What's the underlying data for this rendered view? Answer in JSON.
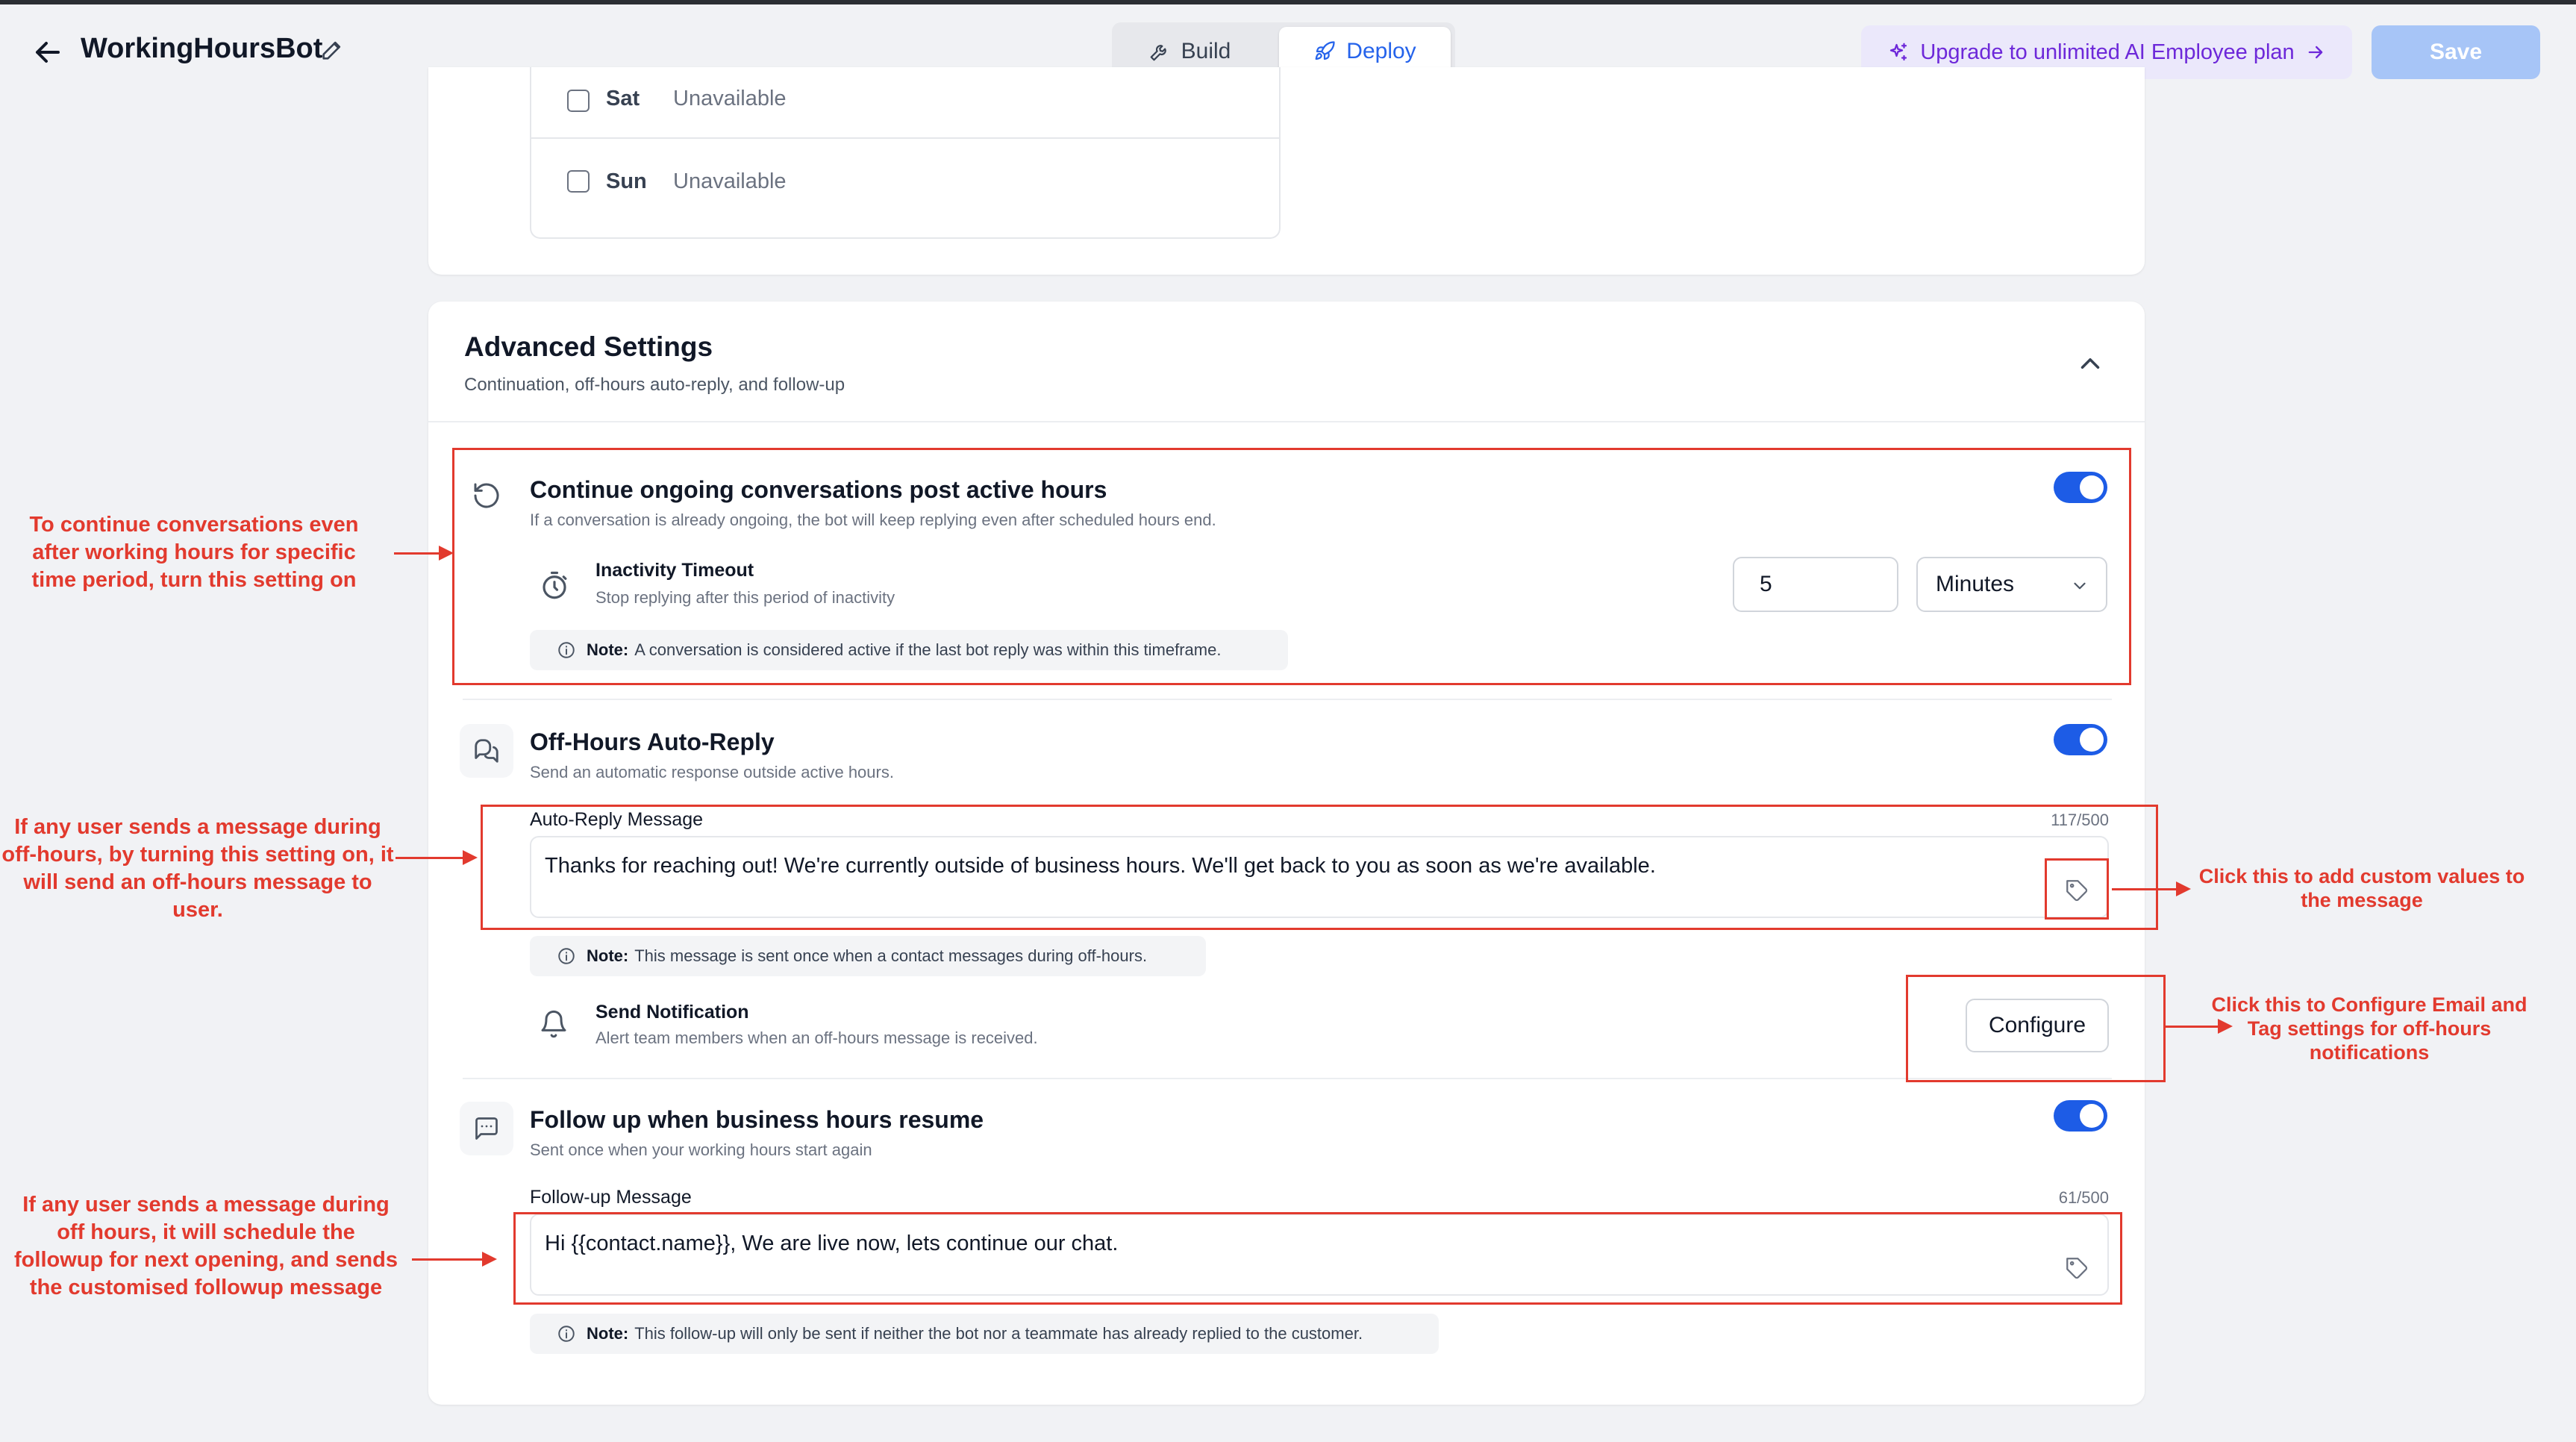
{
  "header": {
    "title": "WorkingHoursBot",
    "tabs": [
      {
        "label": "Build"
      },
      {
        "label": "Deploy"
      }
    ],
    "active_tab": "Deploy",
    "upgrade_label": "Upgrade to unlimited AI Employee plan",
    "save_label": "Save"
  },
  "schedule": {
    "days": [
      {
        "name": "Sat",
        "value": "Unavailable",
        "checked": false
      },
      {
        "name": "Sun",
        "value": "Unavailable",
        "checked": false
      }
    ]
  },
  "advanced": {
    "title": "Advanced Settings",
    "subtitle": "Continuation, off-hours auto-reply, and follow-up",
    "continue": {
      "title": "Continue ongoing conversations post active hours",
      "subtitle": "If a conversation is already ongoing, the bot will keep replying even after scheduled hours end.",
      "enabled": true,
      "timeout_label": "Inactivity Timeout",
      "timeout_sub": "Stop replying after this period of inactivity",
      "timeout_value": "5",
      "timeout_unit": "Minutes",
      "note_prefix": "Note:",
      "note_text": "A conversation is considered active if the last bot reply was within this timeframe."
    },
    "offhours": {
      "title": "Off-Hours Auto-Reply",
      "subtitle": "Send an automatic response outside active hours.",
      "enabled": true,
      "message_label": "Auto-Reply Message",
      "counter": "117/500",
      "message": "Thanks for reaching out! We're currently outside of business hours. We'll get back to you as soon as we're available.",
      "note_prefix": "Note:",
      "note_text": "This message is sent once when a contact messages during off-hours.",
      "notify_label": "Send Notification",
      "notify_sub": "Alert team members when an off-hours message is received.",
      "configure_label": "Configure"
    },
    "followup": {
      "title": "Follow up when business hours resume",
      "subtitle": "Sent once when your working hours start again",
      "enabled": true,
      "message_label": "Follow-up Message",
      "counter": "61/500",
      "message": "Hi {{contact.name}}, We are live now, lets continue our chat.",
      "note_prefix": "Note:",
      "note_text": "This follow-up will only be sent if neither the bot nor a teammate has already replied to the customer."
    }
  },
  "annotations": {
    "a1": "To continue conversations even after working hours for specific time period, turn this setting on",
    "a2": "If any user sends a message during off-hours, by turning this setting on, it will send an off-hours message to user.",
    "a3": "If any user sends a message during off hours, it will schedule the followup for next opening, and sends the customised followup message",
    "a4": "Click this to add custom values to the message",
    "a5": "Click this to Configure Email and Tag settings for off-hours notifications"
  },
  "colors": {
    "accent": "#2563eb",
    "toggle_on": "#1d5ce6",
    "upgrade_text": "#6d28d9",
    "annotation_red": "#e23a2e"
  }
}
